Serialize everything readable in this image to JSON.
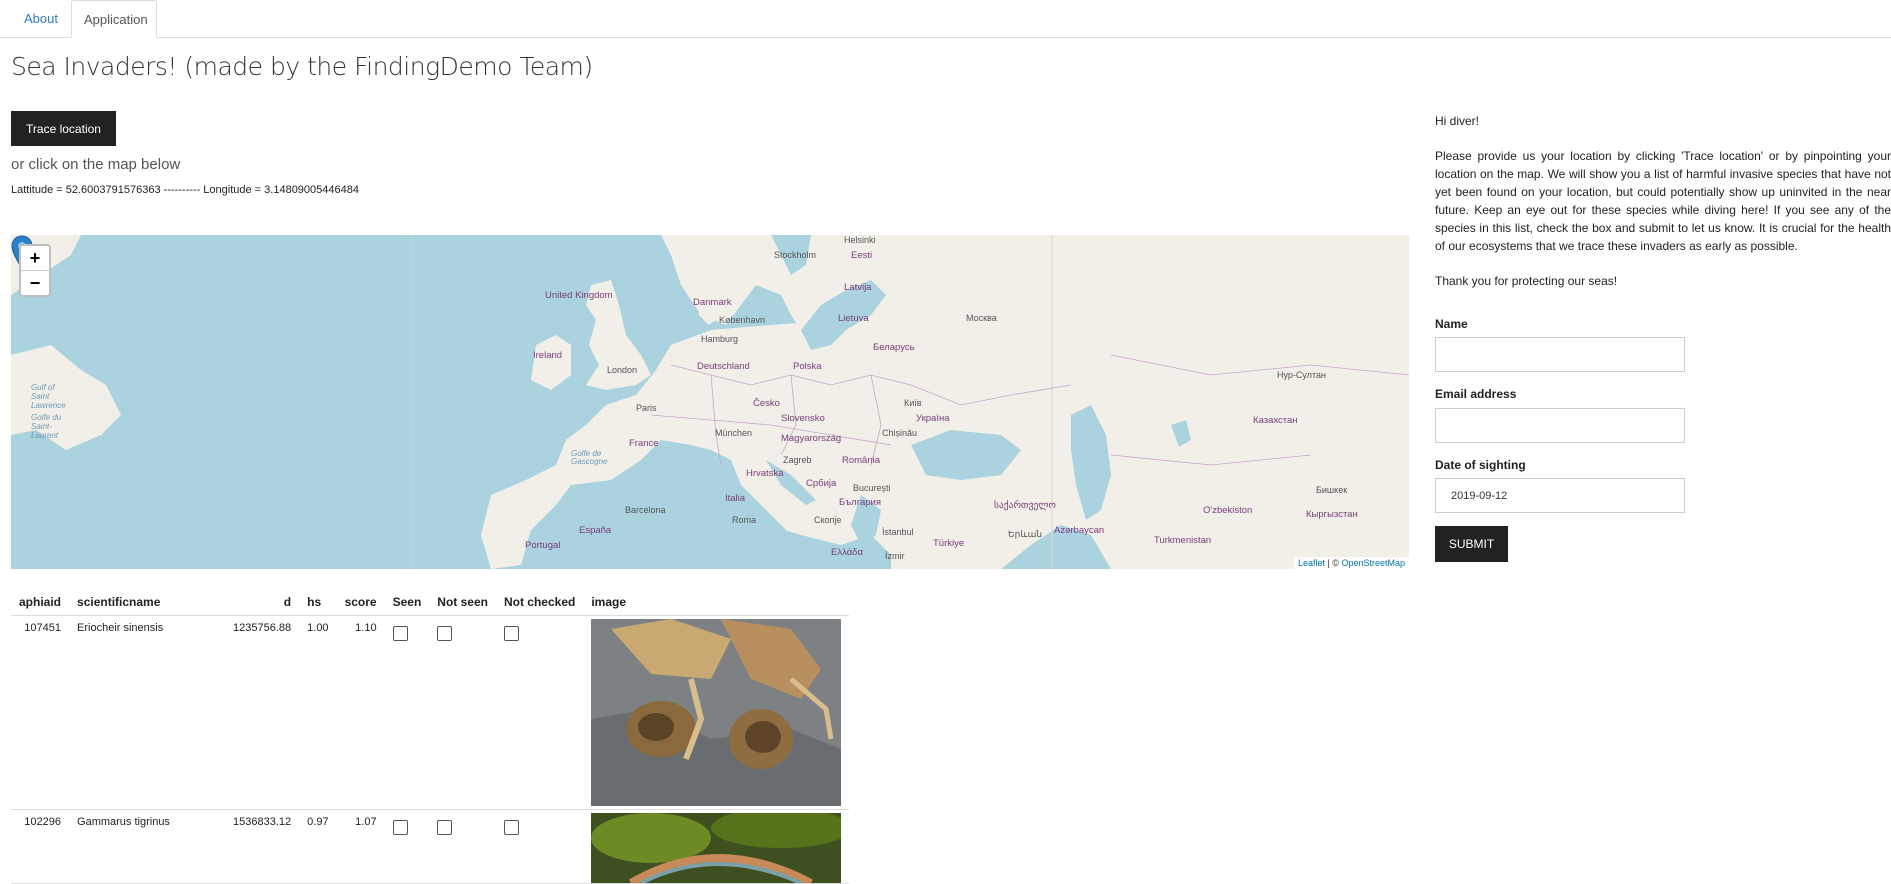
{
  "tabs": [
    {
      "label": "About"
    },
    {
      "label": "Application"
    }
  ],
  "title": "Sea Invaders! (made by the FindingDemo Team)",
  "trace_button": "Trace location",
  "or_click": "or click on the map below",
  "coords": "Lattitude = 52.6003791576363 ---------- Longitude = 3.14809005446484",
  "map": {
    "zoom_in": "+",
    "zoom_out": "−",
    "attribution_leaflet": "Leaflet",
    "attribution_sep": " | © ",
    "attribution_osm": "OpenStreetMap",
    "labels": [
      "Helsinki",
      "Stockholm",
      "Eesti",
      "Latvija",
      "Danmark",
      "København",
      "Lietuva",
      "Москва",
      "United Kingdom",
      "Hamburg",
      "Беларусь",
      "Ireland",
      "London",
      "Deutschland",
      "Polska",
      "Нур-Султан",
      "Gulf of Saint Lawrence",
      "Golfe du Saint-Laurent",
      "Česko",
      "Київ",
      "Paris",
      "Slovensko",
      "Україна",
      "Казахстан",
      "München",
      "Chișinău",
      "France",
      "Magyarország",
      "Zagreb",
      "România",
      "Golfe de Gascogne",
      "Hrvatska",
      "Србија",
      "București",
      "Бишкек",
      "Italia",
      "България",
      "O'zbekiston",
      "Barcelona",
      "საქართველო",
      "Кыргызстан",
      "España",
      "Roma",
      "Скопје",
      "İstanbul",
      "Azərbaycan",
      "Portugal",
      "Türkiye",
      "Ελλάδα",
      "İzmir",
      "Երևան",
      "Turkmenistan"
    ]
  },
  "table": {
    "headers": [
      "aphiaid",
      "scientificname",
      "d",
      "hs",
      "score",
      "Seen",
      "Not seen",
      "Not checked",
      "image"
    ],
    "rows": [
      {
        "aphiaid": "107451",
        "scientificname": "Eriocheir sinensis",
        "d": "1235756.88",
        "hs": "1.00",
        "score": "1.10"
      },
      {
        "aphiaid": "102296",
        "scientificname": "Gammarus tigrinus",
        "d": "1536833.12",
        "hs": "0.97",
        "score": "1.07"
      }
    ]
  },
  "side": {
    "greeting": "Hi diver!",
    "instructions": "Please provide us your location by clicking 'Trace location' or by pinpointing your location on the map. We will show you a list of harmful invasive species that have not yet been found on your location, but could potentially show up uninvited in the near future. Keep an eye out for these species while diving here! If you see any of the species in this list, check the box and submit to let us know. It is crucial for the health of our ecosystems that we trace these invaders as early as possible.",
    "thanks": "Thank you for protecting our seas!"
  },
  "form": {
    "name_label": "Name",
    "name_value": "",
    "email_label": "Email address",
    "email_value": "",
    "date_label": "Date of sighting",
    "date_value": "2019-09-12",
    "submit_label": "SUBMIT"
  },
  "colors": {
    "sea": "#aad3df",
    "land": "#f2efe9",
    "button": "#222222",
    "pin": "#2a81cb"
  }
}
